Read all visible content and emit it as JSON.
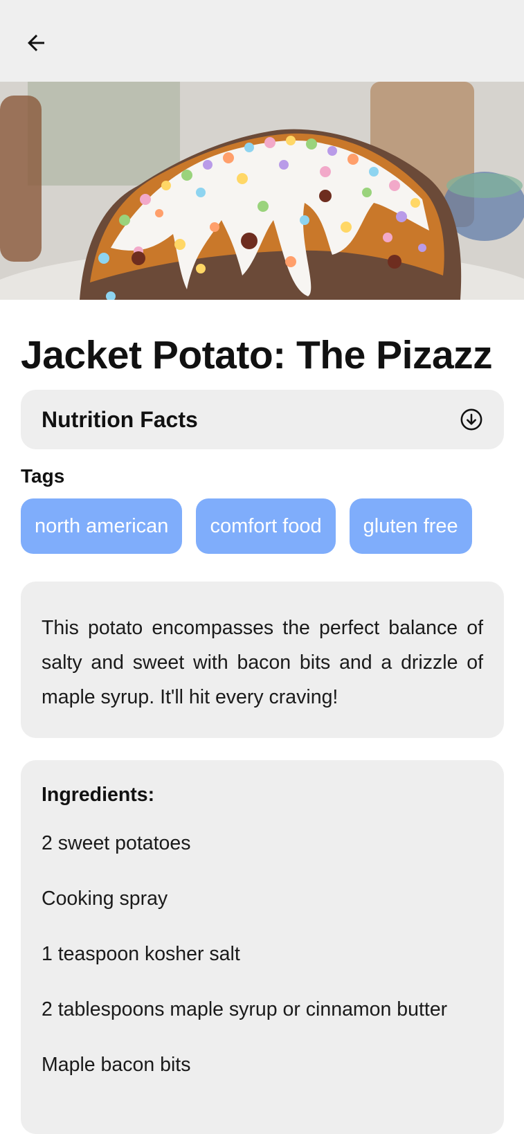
{
  "header": {
    "back_icon": "arrow-left-icon"
  },
  "hero": {
    "image_alt": "Baked sweet potato with white drizzle and colorful sprinkles"
  },
  "recipe": {
    "title": "Jacket Potato: The Pizazz",
    "nutrition": {
      "label": "Nutrition Facts",
      "icon": "circle-arrow-down-icon"
    },
    "tags_heading": "Tags",
    "tags": [
      {
        "label": "north american"
      },
      {
        "label": "comfort food"
      },
      {
        "label": "gluten free"
      }
    ],
    "description": "This potato encompasses the perfect balance of salty and sweet with bacon bits and a drizzle of maple syrup. It'll hit every craving!",
    "ingredients_heading": "Ingredients:",
    "ingredients": [
      "2 sweet potatoes",
      "Cooking spray",
      "1 teaspoon kosher salt",
      "2 tablespoons maple syrup or cinnamon butter",
      "Maple bacon bits"
    ]
  },
  "colors": {
    "tag_bg": "#7fadfb",
    "card_bg": "#eeeeee",
    "topbar_bg": "#efefef"
  }
}
